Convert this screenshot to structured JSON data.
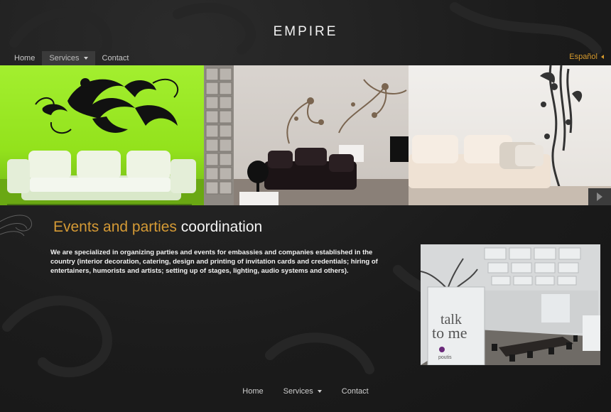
{
  "logo": "EMPIRE",
  "top_nav": {
    "items": [
      "Home",
      "Services",
      "Contact"
    ],
    "active": "Services"
  },
  "language": "Español",
  "hero": {
    "panels": [
      "living-room-green-wall",
      "living-room-floral-wall",
      "living-room-white-wall"
    ],
    "next_icon": "arrow-right-icon"
  },
  "content": {
    "title_part1": "Events and parties",
    "title_part2": " coordination",
    "description": "We are specialized in organizing parties and events for embassies and companies established in the country (interior decoration, catering, design and printing of invitation cards and credentials; hiring of entertainers, humorists and artists; setting up of stages, lighting, audio systems and others).",
    "image_text_line1": "talk",
    "image_text_line2": "to me",
    "image_logo_text": "poutis"
  },
  "footer_nav": {
    "items": [
      "Home",
      "Services",
      "Contact"
    ]
  },
  "colors": {
    "accent": "#d59a35",
    "background": "#1e1e1e",
    "green_wall": "#93e21c"
  }
}
